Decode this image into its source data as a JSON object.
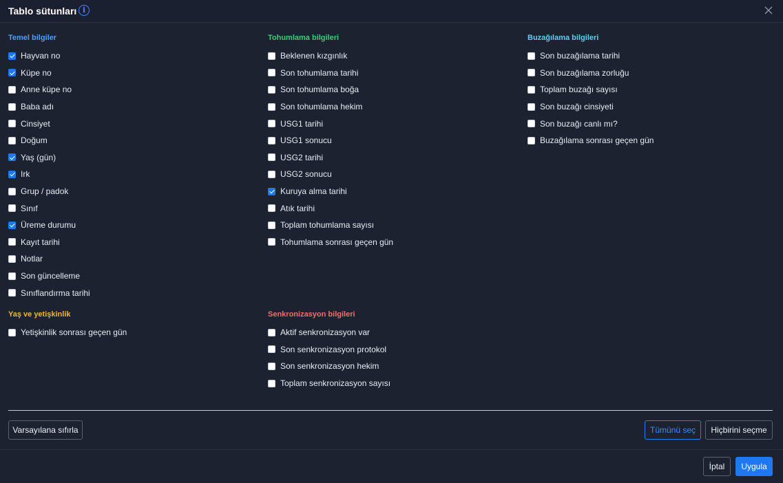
{
  "dialog": {
    "title": "Tablo sütunları",
    "info_icon": "info-icon",
    "close_icon": "close-icon",
    "colors": {
      "temel": "#4f9cf9",
      "tohumlama": "#3ec97c",
      "buzagilama": "#5ad0f0",
      "yas": "#f2b632",
      "senkronizasyon": "#f0706a"
    }
  },
  "sections": {
    "temel": {
      "title": "Temel bilgiler",
      "items": [
        {
          "label": "Hayvan no",
          "checked": true
        },
        {
          "label": "Küpe no",
          "checked": true
        },
        {
          "label": "Anne küpe no",
          "checked": false
        },
        {
          "label": "Baba adı",
          "checked": false
        },
        {
          "label": "Cinsiyet",
          "checked": false
        },
        {
          "label": "Doğum",
          "checked": false
        },
        {
          "label": "Yaş (gün)",
          "checked": true
        },
        {
          "label": "Irk",
          "checked": true
        },
        {
          "label": "Grup / padok",
          "checked": false
        },
        {
          "label": "Sınıf",
          "checked": false
        },
        {
          "label": "Üreme durumu",
          "checked": true
        },
        {
          "label": "Kayıt tarihi",
          "checked": false
        },
        {
          "label": "Notlar",
          "checked": false
        },
        {
          "label": "Son güncelleme",
          "checked": false
        },
        {
          "label": "Sınıflandırma tarihi",
          "checked": false
        }
      ]
    },
    "tohumlama": {
      "title": "Tohumlama bilgileri",
      "items": [
        {
          "label": "Beklenen kızgınlık",
          "checked": false
        },
        {
          "label": "Son tohumlama tarihi",
          "checked": false
        },
        {
          "label": "Son tohumlama boğa",
          "checked": false
        },
        {
          "label": "Son tohumlama hekim",
          "checked": false
        },
        {
          "label": "USG1 tarihi",
          "checked": false
        },
        {
          "label": "USG1 sonucu",
          "checked": false
        },
        {
          "label": "USG2 tarihi",
          "checked": false
        },
        {
          "label": "USG2 sonucu",
          "checked": false
        },
        {
          "label": "Kuruya alma tarihi",
          "checked": true
        },
        {
          "label": "Atık tarihi",
          "checked": false
        },
        {
          "label": "Toplam tohumlama sayısı",
          "checked": false
        },
        {
          "label": "Tohumlama sonrası geçen gün",
          "checked": false
        }
      ]
    },
    "buzagilama": {
      "title": "Buzağılama bilgileri",
      "items": [
        {
          "label": "Son buzağılama tarihi",
          "checked": false
        },
        {
          "label": "Son buzağılama zorluğu",
          "checked": false
        },
        {
          "label": "Toplam buzağı sayısı",
          "checked": false
        },
        {
          "label": "Son buzağı cinsiyeti",
          "checked": false
        },
        {
          "label": "Son buzağı canlı mı?",
          "checked": false
        },
        {
          "label": "Buzağılama sonrası geçen gün",
          "checked": false
        }
      ]
    },
    "yas": {
      "title": "Yaş ve yetişkinlik",
      "items": [
        {
          "label": "Yetişkinlik sonrası geçen gün",
          "checked": false
        }
      ]
    },
    "senkronizasyon": {
      "title": "Senkronizasyon bilgileri",
      "items": [
        {
          "label": "Aktif senkronizasyon var",
          "checked": false
        },
        {
          "label": "Son senkronizasyon protokol",
          "checked": false
        },
        {
          "label": "Son senkronizasyon hekim",
          "checked": false
        },
        {
          "label": "Toplam senkronizasyon sayısı",
          "checked": false
        }
      ]
    }
  },
  "actions": {
    "reset": "Varsayılana sıfırla",
    "select_all": "Tümünü seç",
    "select_none": "Hiçbirini seçme",
    "cancel": "İptal",
    "apply": "Uygula"
  }
}
